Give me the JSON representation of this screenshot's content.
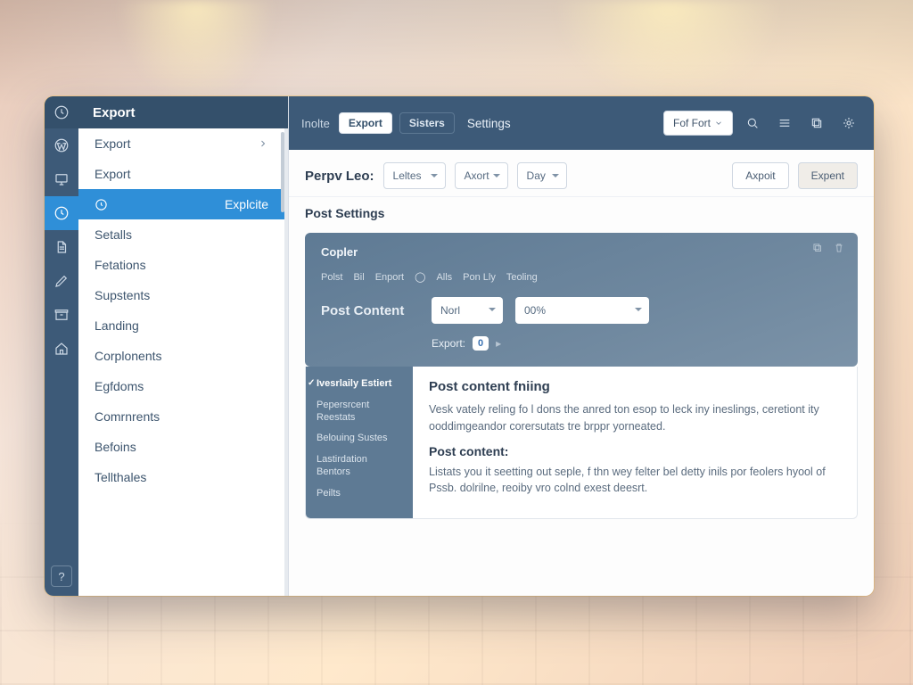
{
  "rail": {
    "help": "?"
  },
  "titlebar": {
    "title": "Export"
  },
  "sidebar": {
    "items": [
      {
        "label": "Export",
        "has_sub": true
      },
      {
        "label": "Export"
      },
      {
        "label": "Explcite",
        "active": true,
        "icon": true
      },
      {
        "label": "Setalls"
      },
      {
        "label": "Fetations"
      },
      {
        "label": "Supstents"
      },
      {
        "label": "Landing"
      },
      {
        "label": "Corplonents"
      },
      {
        "label": "Egfdoms"
      },
      {
        "label": "Comrnrents"
      },
      {
        "label": "Befoins"
      },
      {
        "label": "Tellthales"
      }
    ]
  },
  "topbar": {
    "crumb": "Inolte",
    "pill1": "Export",
    "pill2": "Sisters",
    "tab": "Settings",
    "fontbtn": "Fof Fort"
  },
  "filters": {
    "label": "Perpv Leo:",
    "sel1": "Leltes",
    "sel2": "Axort",
    "sel3": "Day",
    "btn1": "Axpoit",
    "btn2": "Expent"
  },
  "section": {
    "title": "Post Settings"
  },
  "panel": {
    "h1": "Copler",
    "meta": [
      "Polst",
      "Bil",
      "Enport",
      "Alls",
      "Pon Lly",
      "Teoling"
    ],
    "row_label": "Post Content",
    "sel_a": "Norl",
    "sel_b": "00%",
    "export_label": "Export:",
    "export_chip": "0"
  },
  "subnav": {
    "items": [
      {
        "label": "Ivesrlaily Estiert",
        "on": true
      },
      {
        "label": "Pepersrcent Reestats"
      },
      {
        "label": "Belouing Sustes"
      },
      {
        "label": "Lastirdation Bentors"
      },
      {
        "label": "Peilts"
      }
    ]
  },
  "doc": {
    "h3": "Post content fniing",
    "p1": "Vesk vately reling fo l dons the anred ton esop to leck iny ineslings, ceretiont ity ooddimgeandor corersutats tre brppr yorneated.",
    "h4": "Post content:",
    "p2": "Listats you it seetting out seple, f thn wey felter bel detty inils por feolers hyool of Pssb. dolrilne, reoiby vro colnd exest deesrt."
  }
}
